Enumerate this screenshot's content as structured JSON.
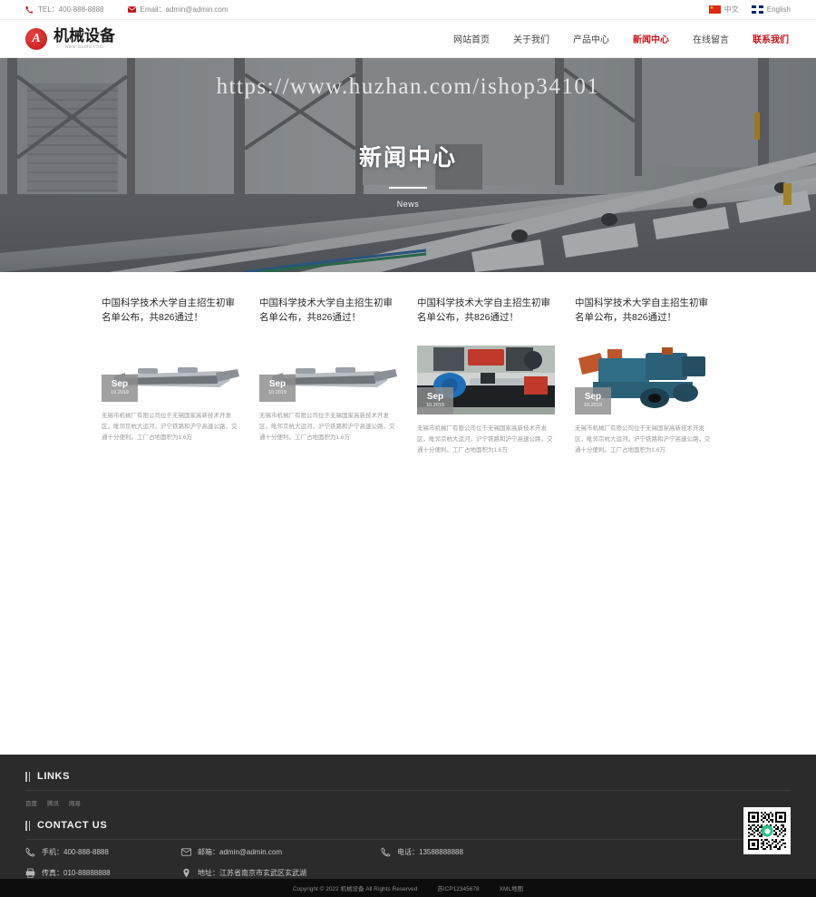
{
  "topbar": {
    "tel": "TEL：400-888-8888",
    "email": "Email：admin@admin.com",
    "lang_cn": "中文",
    "lang_en": "English"
  },
  "header": {
    "logo_cn": "机械设备",
    "logo_url": "www.baidu.com",
    "logo_letter": "A",
    "nav": [
      {
        "label": "网站首页",
        "state": "normal"
      },
      {
        "label": "关于我们",
        "state": "normal"
      },
      {
        "label": "产品中心",
        "state": "normal"
      },
      {
        "label": "新闻中心",
        "state": "active"
      },
      {
        "label": "在线留言",
        "state": "normal"
      },
      {
        "label": "联系我们",
        "state": "accent"
      }
    ]
  },
  "hero": {
    "watermark": "https://www.huzhan.com/ishop34101",
    "title": "新闻中心",
    "subtitle": "News"
  },
  "news": [
    {
      "title": "中国科学技术大学自主招生初审名单公布，共826通过！",
      "month": "Sep",
      "date": "10.2019",
      "desc": "无锡市机械厂有限公司位于无锡国家高新技术开发区，毗邻京杭大运河，沪宁铁路和沪宁高速公路，交通十分便利。工厂占地面积为1.6万"
    },
    {
      "title": "中国科学技术大学自主招生初审名单公布，共826通过！",
      "month": "Sep",
      "date": "10.2019",
      "desc": "无锡市机械厂有限公司位于无锡国家高新技术开发区，毗邻京杭大运河，沪宁铁路和沪宁高速公路，交通十分便利。工厂占地面积为1.6万"
    },
    {
      "title": "中国科学技术大学自主招生初审名单公布，共826通过！",
      "month": "Sep",
      "date": "10.2019",
      "desc": "无锡市机械厂有限公司位于无锡国家高新技术开发区，毗邻京杭大运河，沪宁铁路和沪宁高速公路，交通十分便利。工厂占地面积为1.6万"
    },
    {
      "title": "中国科学技术大学自主招生初审名单公布，共826通过！",
      "month": "Sep",
      "date": "10.2019",
      "desc": "无锡市机械厂有限公司位于无锡国家高新技术开发区，毗邻京杭大运河，沪宁铁路和沪宁高速公路，交通十分便利。工厂占地面积为1.6万"
    }
  ],
  "footer": {
    "links_heading": "LINKS",
    "links": [
      "百度",
      "腾讯",
      "网易"
    ],
    "contact_heading": "CONTACT US",
    "contacts": [
      {
        "label": "手机：400-888-8888",
        "icon": "phone-icon"
      },
      {
        "label": "邮箱：admin@admin.com",
        "icon": "mail-icon"
      },
      {
        "label": "电话：13588888888",
        "icon": "telephone-icon"
      },
      {
        "label": "传真：010-88888888",
        "icon": "fax-icon"
      },
      {
        "label": "地址：江苏省南京市玄武区玄武湖",
        "icon": "location-icon"
      }
    ]
  },
  "copyright": {
    "text": "Copyright © 2022 机械设备 All Rights Reserved",
    "icp": "苏ICP12345678",
    "sitemap": "XML地图"
  },
  "colors": {
    "accent": "#c4161c",
    "footer_bg": "#2b2b2b",
    "copybar_bg": "#0d0d0d"
  }
}
